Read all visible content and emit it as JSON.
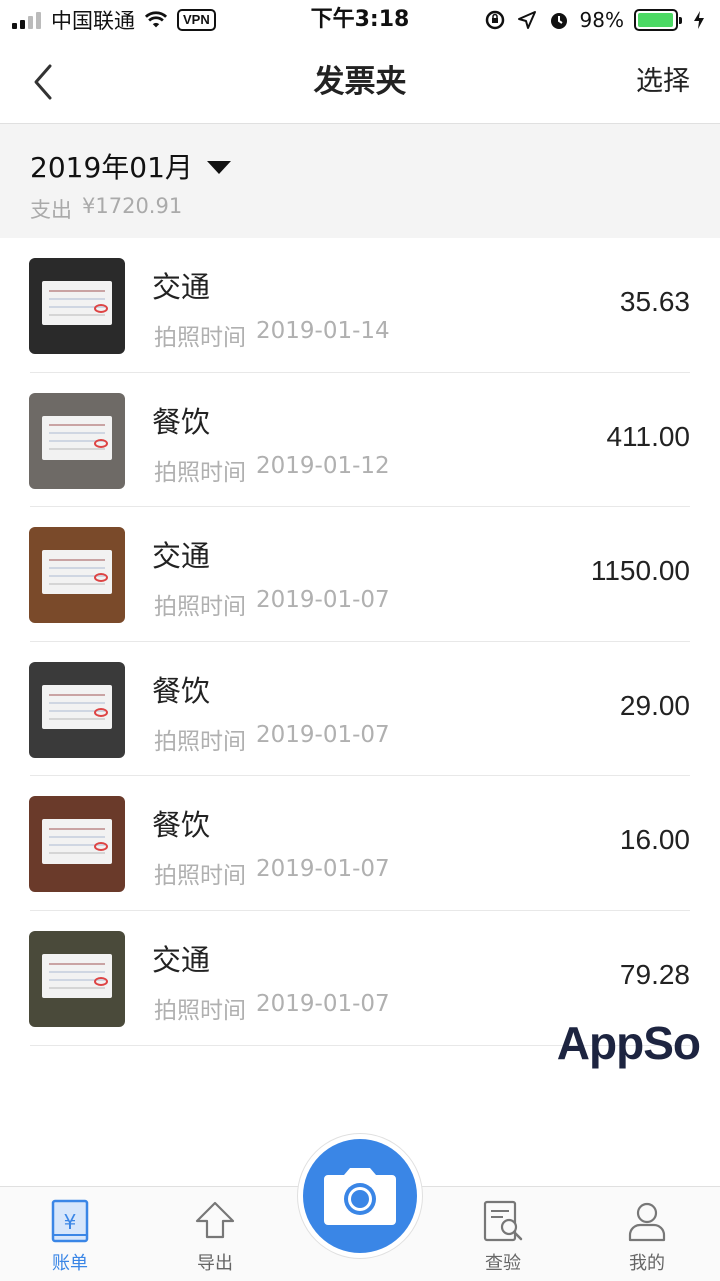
{
  "status_bar": {
    "carrier": "中国联通",
    "vpn": "VPN",
    "time": "下午3:18",
    "battery_pct": "98%",
    "battery_level": 0.98
  },
  "navbar": {
    "title": "发票夹",
    "select_label": "选择"
  },
  "month": {
    "label": "2019年01月",
    "expense_label": "支出",
    "expense_total": "¥1720.91"
  },
  "invoices": [
    {
      "category": "交通",
      "date_label": "拍照时间",
      "date": "2019-01-14",
      "amount": "35.63"
    },
    {
      "category": "餐饮",
      "date_label": "拍照时间",
      "date": "2019-01-12",
      "amount": "411.00"
    },
    {
      "category": "交通",
      "date_label": "拍照时间",
      "date": "2019-01-07",
      "amount": "1150.00"
    },
    {
      "category": "餐饮",
      "date_label": "拍照时间",
      "date": "2019-01-07",
      "amount": "29.00"
    },
    {
      "category": "餐饮",
      "date_label": "拍照时间",
      "date": "2019-01-07",
      "amount": "16.00"
    },
    {
      "category": "交通",
      "date_label": "拍照时间",
      "date": "2019-01-07",
      "amount": "79.28"
    }
  ],
  "thumb_colors": [
    "#2a2a2a",
    "#6e6a66",
    "#7a4a2a",
    "#3a3a3a",
    "#6a3a2a",
    "#4a4a3a"
  ],
  "watermark": "AppSo",
  "tabbar": {
    "bill_label": "账单",
    "export_label": "导出",
    "verify_label": "查验",
    "mine_label": "我的",
    "accent": "#3a86e6"
  }
}
